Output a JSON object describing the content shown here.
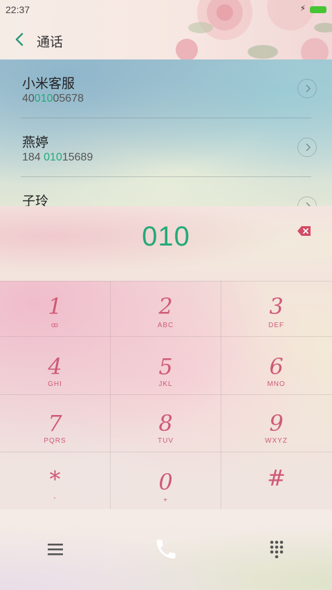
{
  "status_bar": {
    "time": "22:37"
  },
  "header": {
    "title": "通话"
  },
  "contacts": [
    {
      "name": "小米客服",
      "num_pre": "40",
      "num_hl": "010",
      "num_post": "05678"
    },
    {
      "name": "燕婷",
      "num_pre": "184 ",
      "num_hl": "010",
      "num_post": "15689"
    },
    {
      "name": "子玲",
      "num_pre": "",
      "num_hl": "",
      "num_post": ""
    }
  ],
  "dialer": {
    "number": "010",
    "keys": [
      {
        "digit": "1",
        "letters": "ꝏ"
      },
      {
        "digit": "2",
        "letters": "ABC"
      },
      {
        "digit": "3",
        "letters": "DEF"
      },
      {
        "digit": "4",
        "letters": "GHI"
      },
      {
        "digit": "5",
        "letters": "JKL"
      },
      {
        "digit": "6",
        "letters": "MNO"
      },
      {
        "digit": "7",
        "letters": "PQRS"
      },
      {
        "digit": "8",
        "letters": "TUV"
      },
      {
        "digit": "9",
        "letters": "WXYZ"
      },
      {
        "digit": "*",
        "letters": ","
      },
      {
        "digit": "0",
        "letters": "+"
      },
      {
        "digit": "#",
        "letters": ""
      }
    ]
  },
  "icons": {
    "back": "chevron-left-icon",
    "battery": "battery-icon",
    "charging": "lightning-icon",
    "backspace": "backspace-icon",
    "menu": "menu-icon",
    "call": "phone-icon",
    "keypad": "keypad-icon",
    "contact_detail": "chevron-right-icon"
  },
  "colors": {
    "accent": "#23a978",
    "key_text": "#cf5a77",
    "backspace": "#d54a64",
    "battery": "#47c436"
  }
}
